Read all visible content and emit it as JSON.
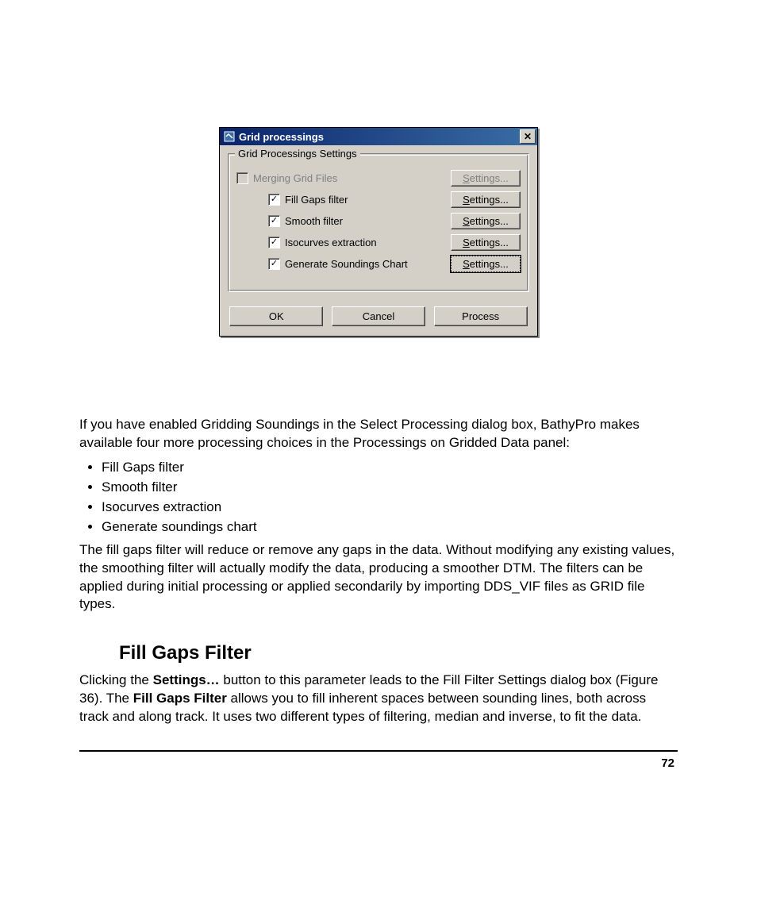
{
  "dialog": {
    "title": "Grid processings",
    "group_label": "Grid Processings Settings",
    "settings_btn": "Settings...",
    "settings_btn_letter": "S",
    "settings_btn_rest": "ettings...",
    "rows": {
      "merging": {
        "label": "Merging Grid Files",
        "checked": false,
        "disabled": true,
        "btn_disabled": true
      },
      "fill": {
        "label": "Fill Gaps filter",
        "checked": true
      },
      "smooth": {
        "label": "Smooth filter",
        "checked": true
      },
      "iso": {
        "label": "Isocurves extraction",
        "checked": true
      },
      "sound": {
        "label": "Generate Soundings Chart",
        "checked": true,
        "focused": true
      }
    },
    "buttons": {
      "ok": "OK",
      "cancel": "Cancel",
      "process": "Process"
    }
  },
  "doc": {
    "p1": "If you have enabled Gridding Soundings in the Select Processing dialog box, BathyPro makes available four more processing choices in the Processings on Gridded Data panel:",
    "bullets": [
      "Fill Gaps filter",
      "Smooth filter",
      "Isocurves extraction",
      "Generate soundings chart"
    ],
    "p2": "The fill gaps filter will reduce or remove any gaps in the data. Without modifying any existing values, the smoothing filter will actually modify the data, producing a smoother DTM. The filters can be applied during initial processing or applied secondarily by importing DDS_VIF files as GRID file types.",
    "h2": "Fill Gaps Filter",
    "p3_a": "Clicking the ",
    "p3_b": "Settings…",
    "p3_c": " button to this parameter leads to the Fill Filter Settings dialog box (Figure 36). The ",
    "p3_d": "Fill Gaps Filter",
    "p3_e": " allows you to fill inherent spaces between sounding lines, both across track and along track. It uses two different types of filtering, median and inverse, to fit the data.",
    "page_number": "72"
  }
}
